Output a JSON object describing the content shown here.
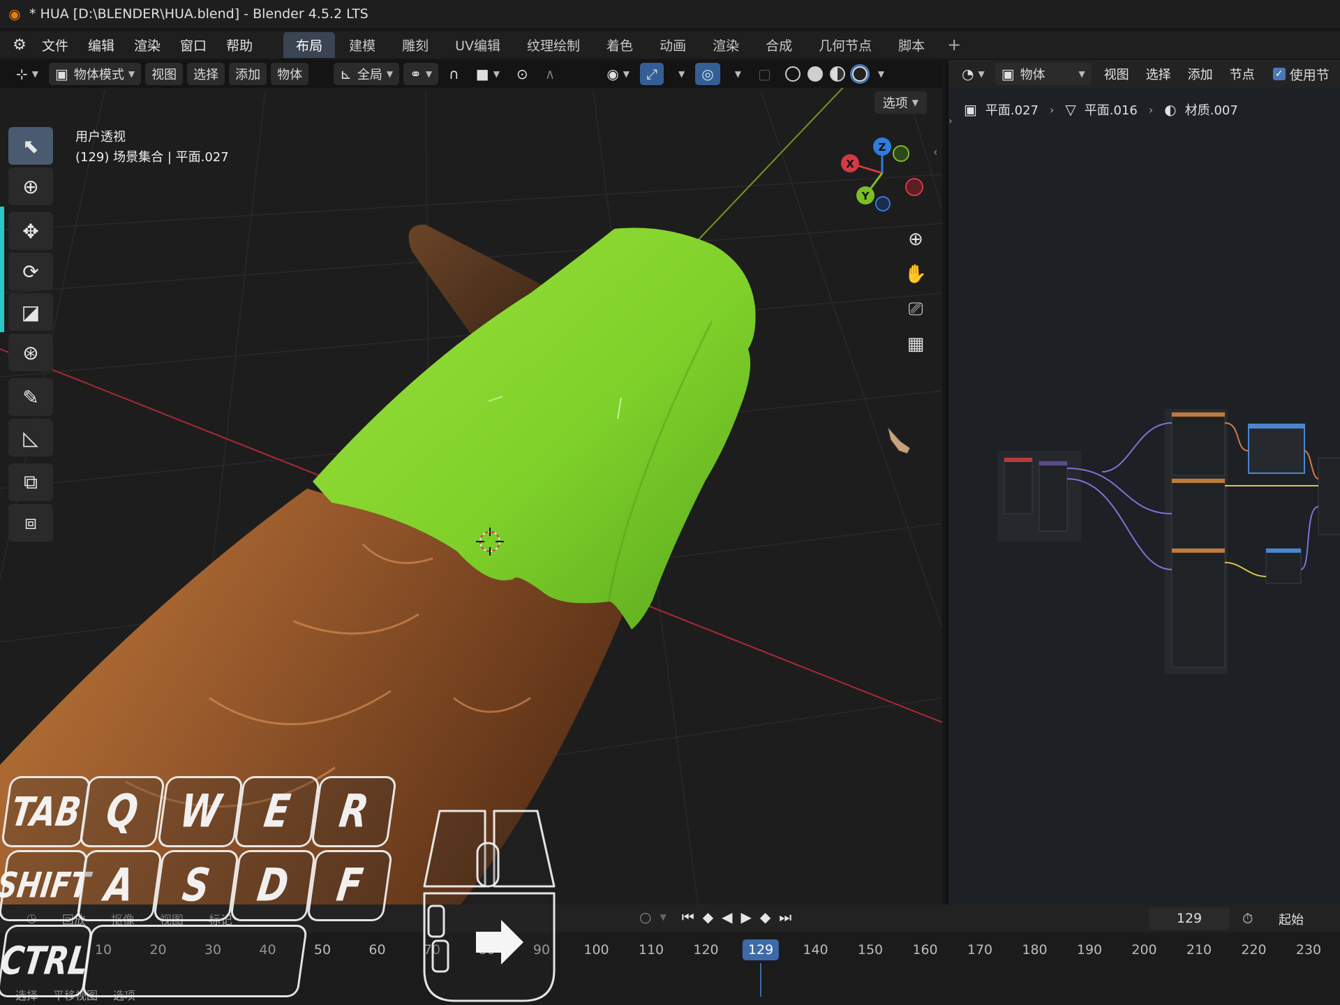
{
  "window": {
    "title": "* HUA [D:\\BLENDER\\HUA.blend] - Blender 4.5.2 LTS"
  },
  "menus": [
    "文件",
    "编辑",
    "渲染",
    "窗口",
    "帮助"
  ],
  "workspaces": [
    "布局",
    "建模",
    "雕刻",
    "UV编辑",
    "纹理绘制",
    "着色",
    "动画",
    "渲染",
    "合成",
    "几何节点",
    "脚本"
  ],
  "workspace_add": "+",
  "viewport_header": {
    "mode": "物体模式",
    "menus": [
      "视图",
      "选择",
      "添加",
      "物体"
    ],
    "orientation": "全局",
    "options": "选项"
  },
  "viewport": {
    "view_name": "用户透视",
    "context": "(129) 场景集合 | 平面.027",
    "gizmo_axes": [
      "Z",
      "X",
      "Y"
    ]
  },
  "node_editor": {
    "type": "物体",
    "menus": [
      "视图",
      "选择",
      "添加",
      "节点"
    ],
    "use_nodes": "使用节",
    "breadcrumbs": [
      "平面.027",
      "平面.016",
      "材质.007"
    ]
  },
  "timeline": {
    "menus": [
      "回放",
      "抠像",
      "视图",
      "标记"
    ],
    "current_frame": "129",
    "start_label": "起始",
    "ticks": [
      "10",
      "20",
      "30",
      "40",
      "50",
      "60",
      "70",
      "80",
      "90",
      "100",
      "110",
      "120",
      "129",
      "140",
      "150",
      "160",
      "170",
      "180",
      "190",
      "200",
      "210",
      "220",
      "230"
    ],
    "status": [
      "选择",
      "平移视图",
      "选项"
    ]
  },
  "key_overlay": {
    "row1": [
      "TAB",
      "Q",
      "W",
      "E",
      "R"
    ],
    "row2": [
      "SHIFT",
      "A",
      "S",
      "D",
      "F"
    ],
    "row3": [
      "CTRL"
    ]
  },
  "colors": {
    "leaf_green": "#7fd12a",
    "wood_brown": "#9a5b2c",
    "x_axis": "#d23a45",
    "y_axis": "#7bbf24",
    "z_axis": "#2f7ddc",
    "accent_blue": "#3d6aa8"
  }
}
